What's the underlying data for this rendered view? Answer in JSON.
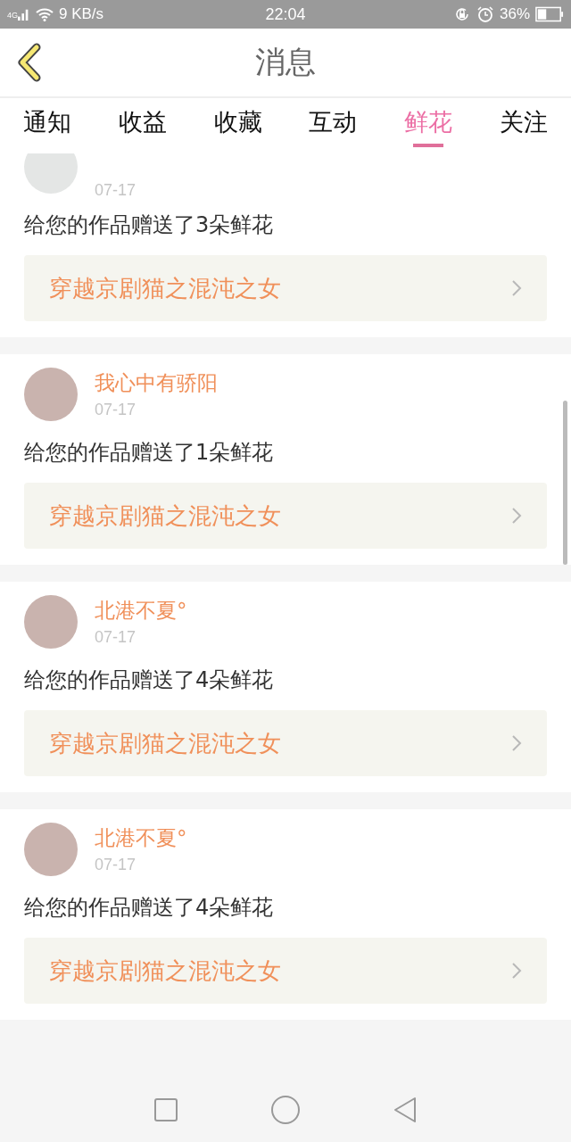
{
  "status_bar": {
    "network": "4G",
    "speed": "9 KB/s",
    "time": "22:04",
    "battery": "36%"
  },
  "header": {
    "title": "消息"
  },
  "tabs": [
    {
      "label": "通知",
      "selected": false
    },
    {
      "label": "收益",
      "selected": false
    },
    {
      "label": "收藏",
      "selected": false
    },
    {
      "label": "互动",
      "selected": false
    },
    {
      "label": "鲜花",
      "selected": true
    },
    {
      "label": "关注",
      "selected": false
    }
  ],
  "messages": [
    {
      "date": "07-17",
      "text": "给您的作品赠送了3朵鲜花",
      "work": "穿越京剧猫之混沌之女"
    },
    {
      "name": "我心中有骄阳",
      "date": "07-17",
      "text": "给您的作品赠送了1朵鲜花",
      "work": "穿越京剧猫之混沌之女"
    },
    {
      "name": "北港不夏°",
      "date": "07-17",
      "text": "给您的作品赠送了4朵鲜花",
      "work": "穿越京剧猫之混沌之女"
    },
    {
      "name": "北港不夏°",
      "date": "07-17",
      "text": "给您的作品赠送了4朵鲜花",
      "work": "穿越京剧猫之混沌之女"
    }
  ]
}
